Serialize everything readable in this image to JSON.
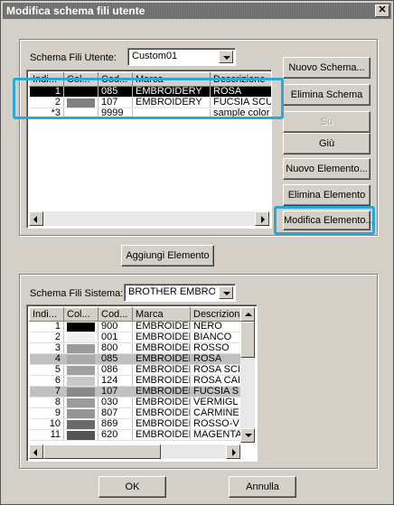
{
  "window": {
    "title": "Modifica schema fili utente",
    "close_glyph": "✕"
  },
  "user_scheme": {
    "label": "Schema Fili Utente:",
    "selected": "Custom01",
    "columns": [
      "Indi...",
      "Col...",
      "Cod...",
      "Marca",
      "Descrizione"
    ],
    "rows": [
      {
        "index": "1",
        "color": "#000000",
        "code": "085",
        "brand": "EMBROIDERY",
        "desc": "ROSA",
        "selected": true
      },
      {
        "index": "2",
        "color": "#808080",
        "code": "107",
        "brand": "EMBROIDERY",
        "desc": "FUCSIA SCUI",
        "selected": false
      },
      {
        "index": "*3",
        "color": "#ffffff",
        "code": "9999",
        "brand": "",
        "desc": "sample color",
        "selected": false
      }
    ]
  },
  "side_buttons": {
    "new_scheme": "Nuovo Schema...",
    "delete_scheme": "Elimina Schema",
    "up": "Su",
    "down": "Giù",
    "new_element": "Nuovo Elemento...",
    "delete_element": "Elimina Elemento",
    "edit_element": "Modifica Elemento..."
  },
  "add_element": "Aggiungi Elemento",
  "system_scheme": {
    "label": "Schema Fili Sistema:",
    "selected": "BROTHER EMBROIDI",
    "columns": [
      "Indi...",
      "Col...",
      "Cod...",
      "Marca",
      "Descrizion"
    ],
    "rows": [
      {
        "index": "1",
        "color": "#000000",
        "code": "900",
        "brand": "EMBROIDERY",
        "desc": "NERO"
      },
      {
        "index": "2",
        "color": "#f0f0f0",
        "code": "001",
        "brand": "EMBROIDERY",
        "desc": "BIANCO"
      },
      {
        "index": "3",
        "color": "#9a9a9a",
        "code": "800",
        "brand": "EMBROIDERY",
        "desc": "ROSSO"
      },
      {
        "index": "4",
        "color": "#a8a8a8",
        "code": "085",
        "brand": "EMBROIDERY",
        "desc": "ROSA",
        "gray": true
      },
      {
        "index": "5",
        "color": "#a0a0a0",
        "code": "086",
        "brand": "EMBROIDERY",
        "desc": "ROSA SCI"
      },
      {
        "index": "6",
        "color": "#c8c8c8",
        "code": "124",
        "brand": "EMBROIDERY",
        "desc": "ROSA CAI"
      },
      {
        "index": "7",
        "color": "#8a8a8a",
        "code": "107",
        "brand": "EMBROIDERY",
        "desc": "FUCSIA S",
        "gray": true
      },
      {
        "index": "8",
        "color": "#9c9c9c",
        "code": "030",
        "brand": "EMBROIDERY",
        "desc": "VERMIGL"
      },
      {
        "index": "9",
        "color": "#959595",
        "code": "807",
        "brand": "EMBROIDERY",
        "desc": "CARMINE"
      },
      {
        "index": "10",
        "color": "#6a6a6a",
        "code": "869",
        "brand": "EMBROIDERY",
        "desc": "ROSSO-V"
      },
      {
        "index": "11",
        "color": "#555555",
        "code": "620",
        "brand": "EMBROIDERY",
        "desc": "MAGENTA"
      }
    ]
  },
  "footer": {
    "ok": "OK",
    "cancel": "Annulla"
  }
}
